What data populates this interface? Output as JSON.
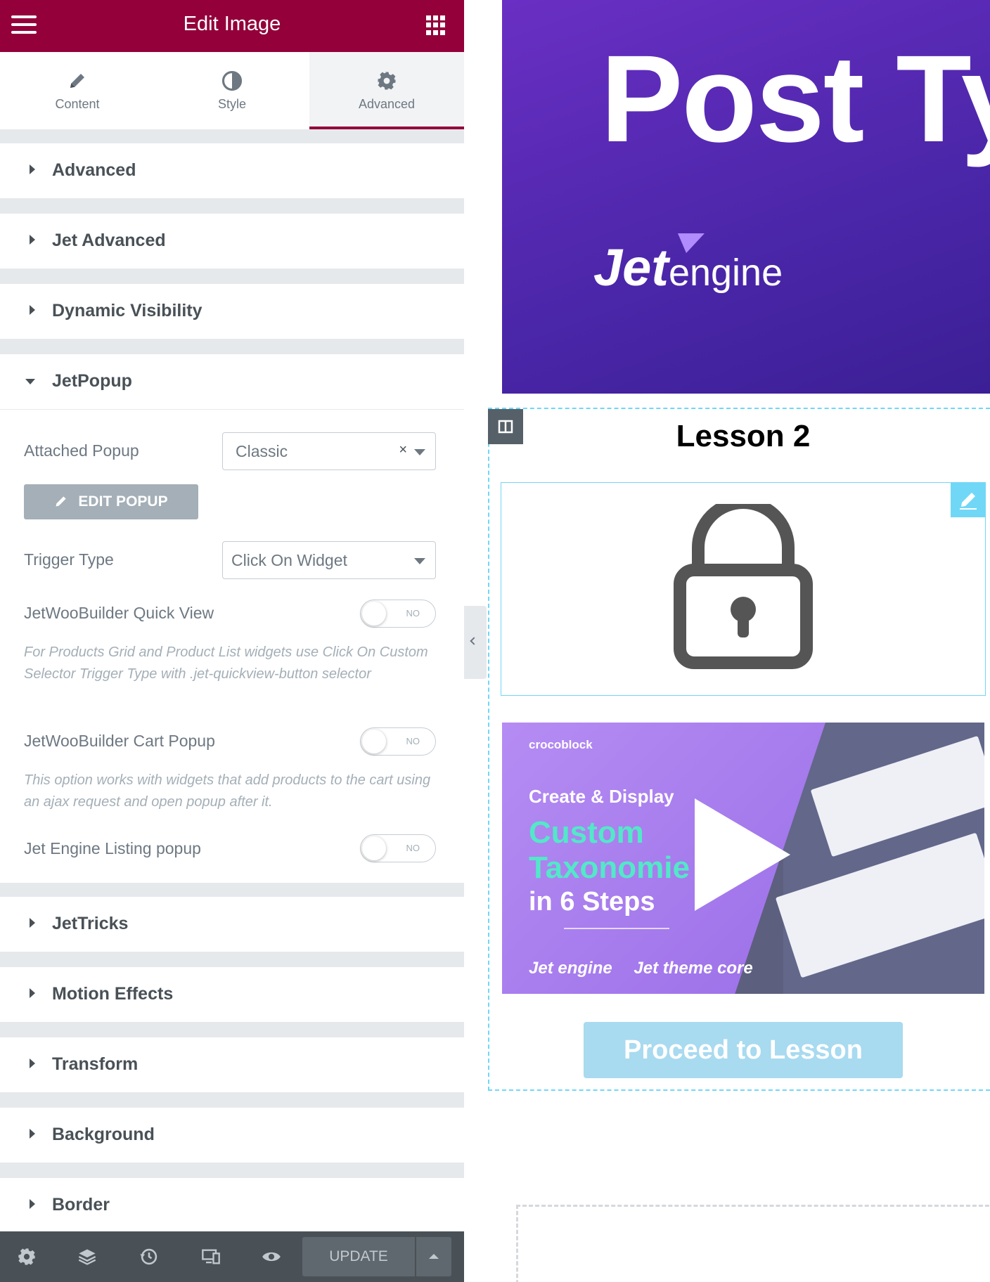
{
  "panel": {
    "header": {
      "title": "Edit Image"
    },
    "tabs": [
      {
        "label": "Content",
        "icon": "pencil-icon"
      },
      {
        "label": "Style",
        "icon": "contrast-icon"
      },
      {
        "label": "Advanced",
        "icon": "gear-icon",
        "active": true
      }
    ],
    "sections": {
      "advanced": "Advanced",
      "jet_advanced": "Jet Advanced",
      "dynamic_visibility": "Dynamic Visibility",
      "jetpopup": "JetPopup",
      "jettricks": "JetTricks",
      "motion_effects": "Motion Effects",
      "transform": "Transform",
      "background": "Background",
      "border": "Border"
    },
    "jetpopup": {
      "attached_popup_label": "Attached Popup",
      "attached_popup_value": "Classic",
      "clear_symbol": "×",
      "edit_popup_label": "EDIT POPUP",
      "trigger_type_label": "Trigger Type",
      "trigger_type_value": "Click On Widget",
      "quick_view_label": "JetWooBuilder Quick View",
      "quick_view_state": "NO",
      "quick_view_desc": "For Products Grid and Product List widgets use Click On Custom Selector Trigger Type with .jet-quickview-button selector",
      "cart_popup_label": "JetWooBuilder Cart Popup",
      "cart_popup_state": "NO",
      "cart_popup_desc": "This option works with widgets that add products to the cart using an ajax request and open popup after it.",
      "listing_popup_label": "Jet Engine Listing popup",
      "listing_popup_state": "NO"
    },
    "footer": {
      "icons": [
        "settings-icon",
        "layers-icon",
        "history-icon",
        "responsive-icon",
        "preview-eye-icon"
      ],
      "update_label": "UPDATE"
    }
  },
  "preview": {
    "hero": {
      "headline": "Post Ty",
      "logo_jet": "Jet",
      "logo_engine": "engine"
    },
    "lesson_title": "Lesson 2",
    "lock_icon": "lock-icon",
    "video": {
      "brand_small": "crocoblock",
      "line1": "Create & Display",
      "line2": "Custom",
      "line3": "Taxonomie",
      "line4": "in 6 Steps",
      "brand_jetengine": "Jet engine",
      "brand_jettheme": "Jet theme core"
    },
    "proceed_label": "Proceed to Lesson"
  },
  "colors": {
    "header_bg": "#93003a",
    "accent_tab": "#93003a",
    "footer_bg": "#495157",
    "hero_gradient_start": "#6a2fc4",
    "button_light_blue": "#a8daf0",
    "container_outline": "#71d7f7",
    "taxonomy_green": "#52e8c8"
  }
}
